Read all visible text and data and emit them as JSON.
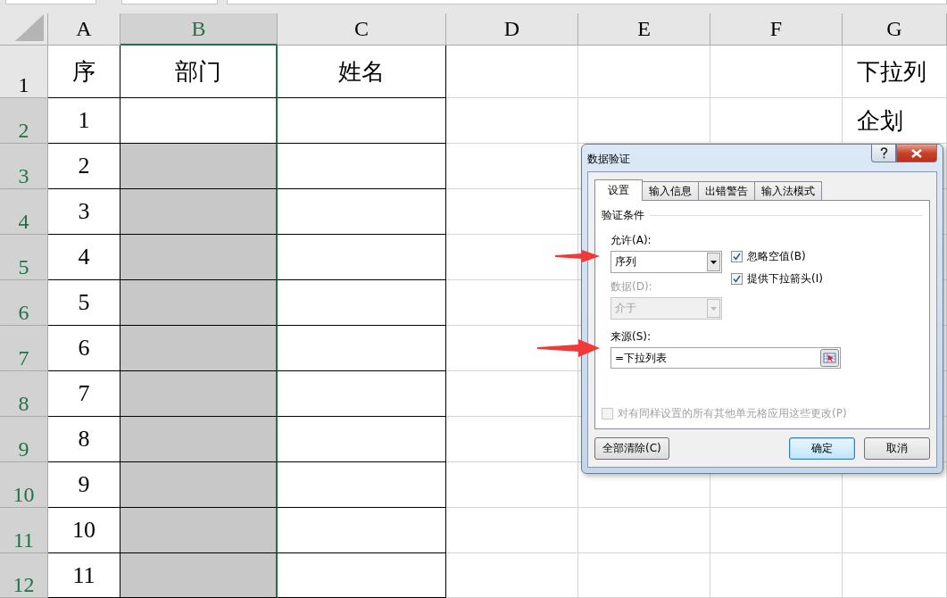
{
  "sheet": {
    "columns": [
      {
        "label": "A",
        "selected": false
      },
      {
        "label": "B",
        "selected": true
      },
      {
        "label": "C",
        "selected": false
      },
      {
        "label": "D",
        "selected": false
      },
      {
        "label": "E",
        "selected": false
      },
      {
        "label": "F",
        "selected": false
      },
      {
        "label": "G",
        "selected": false
      }
    ],
    "rows": [
      {
        "number": "1",
        "selected": false,
        "cells": {
          "a": "序",
          "b": "部门",
          "c": "姓名",
          "g": "下拉列"
        }
      },
      {
        "number": "2",
        "selected": true,
        "cells": {
          "a": "1",
          "g": "企划"
        }
      },
      {
        "number": "3",
        "selected": true,
        "cells": {
          "a": "2"
        }
      },
      {
        "number": "4",
        "selected": true,
        "cells": {
          "a": "3"
        }
      },
      {
        "number": "5",
        "selected": true,
        "cells": {
          "a": "4"
        }
      },
      {
        "number": "6",
        "selected": true,
        "cells": {
          "a": "5"
        }
      },
      {
        "number": "7",
        "selected": true,
        "cells": {
          "a": "6"
        }
      },
      {
        "number": "8",
        "selected": true,
        "cells": {
          "a": "7"
        }
      },
      {
        "number": "9",
        "selected": true,
        "cells": {
          "a": "8"
        }
      },
      {
        "number": "10",
        "selected": true,
        "cells": {
          "a": "9"
        }
      },
      {
        "number": "11",
        "selected": true,
        "cells": {
          "a": "10"
        }
      },
      {
        "number": "12",
        "selected": true,
        "cells": {
          "a": "11"
        }
      }
    ]
  },
  "dialog": {
    "title": "数据验证",
    "tabs": [
      {
        "label": "设置",
        "selected": true
      },
      {
        "label": "输入信息",
        "selected": false
      },
      {
        "label": "出错警告",
        "selected": false
      },
      {
        "label": "输入法模式",
        "selected": false
      }
    ],
    "section_title": "验证条件",
    "allow": {
      "label": "允许(A):",
      "value": "序列",
      "disabled": false
    },
    "data": {
      "label": "数据(D):",
      "value": "介于",
      "disabled": true
    },
    "options": [
      {
        "label": "忽略空值(B)",
        "checked": true
      },
      {
        "label": "提供下拉箭头(I)",
        "checked": true
      }
    ],
    "source": {
      "label": "来源(S):",
      "value": "=下拉列表"
    },
    "apply_all": {
      "label": "对有同样设置的所有其他单元格应用这些更改(P)",
      "checked": false,
      "disabled": true
    },
    "buttons": [
      {
        "label": "全部清除(C)",
        "kind": "left"
      },
      {
        "label": "确定",
        "kind": "default"
      },
      {
        "label": "取消",
        "kind": "normal"
      }
    ]
  }
}
